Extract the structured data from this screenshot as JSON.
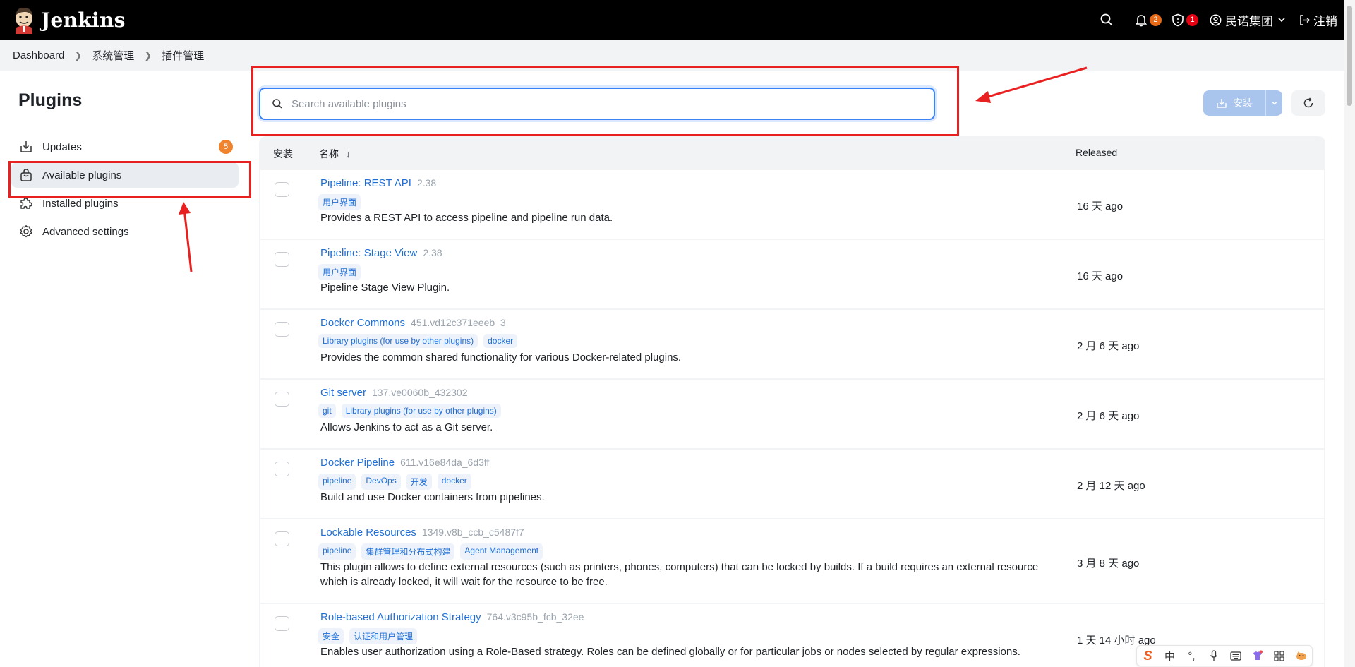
{
  "header": {
    "brand": "Jenkins",
    "notifications_count": "2",
    "security_count": "1",
    "user_name": "民诺集团",
    "logout_label": "注销"
  },
  "breadcrumb": [
    "Dashboard",
    "系统管理",
    "插件管理"
  ],
  "sidebar": {
    "title": "Plugins",
    "items": [
      {
        "label": "Updates",
        "icon": "download-icon",
        "badge": "5"
      },
      {
        "label": "Available plugins",
        "icon": "shopping-bag-icon",
        "active": true
      },
      {
        "label": "Installed plugins",
        "icon": "puzzle-icon"
      },
      {
        "label": "Advanced settings",
        "icon": "gear-icon"
      }
    ]
  },
  "search": {
    "placeholder": "Search available plugins",
    "value": ""
  },
  "actions": {
    "install_label": "安装"
  },
  "table": {
    "headers": {
      "install": "安装",
      "name": "名称",
      "sort_indicator": "↓",
      "released": "Released"
    },
    "rows": [
      {
        "name": "Pipeline: REST API",
        "version": "2.38",
        "tags": [
          "用户界面"
        ],
        "description": "Provides a REST API to access pipeline and pipeline run data.",
        "released": "16 天 ago"
      },
      {
        "name": "Pipeline: Stage View",
        "version": "2.38",
        "tags": [
          "用户界面"
        ],
        "description": "Pipeline Stage View Plugin.",
        "released": "16 天 ago"
      },
      {
        "name": "Docker Commons",
        "version": "451.vd12c371eeeb_3",
        "tags": [
          "Library plugins (for use by other plugins)",
          "docker"
        ],
        "description": "Provides the common shared functionality for various Docker-related plugins.",
        "released": "2 月 6 天 ago"
      },
      {
        "name": "Git server",
        "version": "137.ve0060b_432302",
        "tags": [
          "git",
          "Library plugins (for use by other plugins)"
        ],
        "description": "Allows Jenkins to act as a Git server.",
        "released": "2 月 6 天 ago"
      },
      {
        "name": "Docker Pipeline",
        "version": "611.v16e84da_6d3ff",
        "tags": [
          "pipeline",
          "DevOps",
          "开发",
          "docker"
        ],
        "description": "Build and use Docker containers from pipelines.",
        "released": "2 月 12 天 ago"
      },
      {
        "name": "Lockable Resources",
        "version": "1349.v8b_ccb_c5487f7",
        "tags": [
          "pipeline",
          "集群管理和分布式构建",
          "Agent Management"
        ],
        "description": "This plugin allows to define external resources (such as printers, phones, computers) that can be locked by builds. If a build requires an external resource which is already locked, it will wait for the resource to be free.",
        "released": "3 月 8 天 ago"
      },
      {
        "name": "Role-based Authorization Strategy",
        "version": "764.v3c95b_fcb_32ee",
        "tags": [
          "安全",
          "认证和用户管理"
        ],
        "description": "Enables user authorization using a Role-Based strategy. Roles can be defined globally or for particular jobs or nodes selected by regular expressions.",
        "released": "1 天 14 小时 ago"
      }
    ]
  },
  "ime_toolbar": {
    "mode": "中"
  },
  "colors": {
    "annotation": "#e8201f",
    "link": "#1f6fd6",
    "header_bg": "#000000"
  }
}
